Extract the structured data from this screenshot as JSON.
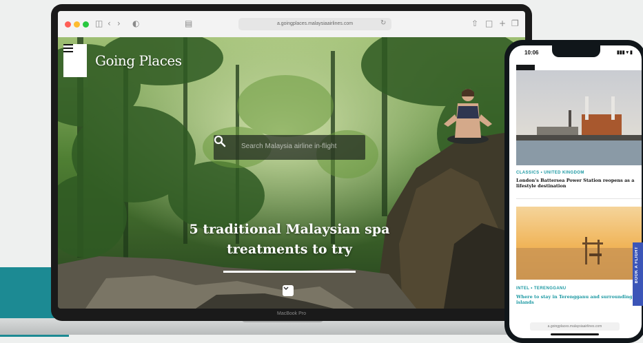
{
  "browser": {
    "url": "a.goingplaces.malaysiaairlines.com",
    "toolbar_icons": [
      "sidebar-icon",
      "back-icon",
      "forward-icon",
      "privacy-icon",
      "refresh-icon",
      "share-icon",
      "new-tab-icon",
      "tabs-icon"
    ]
  },
  "website": {
    "brand": "Going Places",
    "search_placeholder": "Search Malaysia airline in-flight",
    "headline": "5 traditional Malaysian spa treatments to try",
    "laptop_label": "MacBook Pro"
  },
  "phone": {
    "time": "10:06",
    "status": "▮▮▮ ▾ ▮",
    "cards": [
      {
        "category": "CLASSICS • UNITED KINGDOM",
        "title": "London's Battersea Power Station reopens as a lifestyle destination"
      },
      {
        "category": "INTEL • TERENGGANU",
        "title": "Where to stay in Terengganu and surrounding islands"
      }
    ],
    "address": "a.goingplaces.malaysiaairlines.com",
    "book_tab": "BOOK A FLIGHT"
  },
  "colors": {
    "accent_teal": "#1c8a93",
    "category_teal": "#1a98a2",
    "book_tab_blue": "#3b55b8"
  }
}
